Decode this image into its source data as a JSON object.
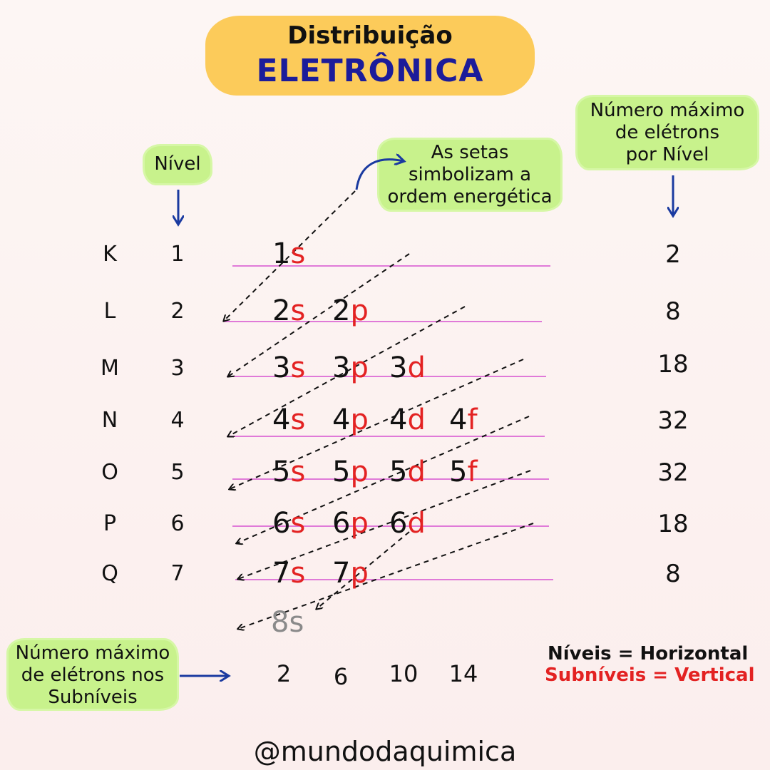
{
  "title": {
    "line1": "Distribuição",
    "line2": "ELETRÔNICA"
  },
  "notes": {
    "level": "Nível",
    "max_per_level": [
      "Número máximo",
      "de elétrons",
      "por Nível"
    ],
    "arrows": [
      "As setas",
      "simbolizam a",
      "ordem energética"
    ],
    "max_per_sublevel": [
      "Número máximo",
      "de elétrons nos",
      "Subníveis"
    ]
  },
  "rows": [
    {
      "shell": "K",
      "level": "1",
      "capacity": "2",
      "subs": [
        [
          "1",
          "s"
        ]
      ]
    },
    {
      "shell": "L",
      "level": "2",
      "capacity": "8",
      "subs": [
        [
          "2",
          "s"
        ],
        [
          "2",
          "p"
        ]
      ]
    },
    {
      "shell": "M",
      "level": "3",
      "capacity": "18",
      "subs": [
        [
          "3",
          "s"
        ],
        [
          "3",
          "p"
        ],
        [
          "3",
          "d"
        ]
      ]
    },
    {
      "shell": "N",
      "level": "4",
      "capacity": "32",
      "subs": [
        [
          "4",
          "s"
        ],
        [
          "4",
          "p"
        ],
        [
          "4",
          "d"
        ],
        [
          "4",
          "f"
        ]
      ]
    },
    {
      "shell": "O",
      "level": "5",
      "capacity": "32",
      "subs": [
        [
          "5",
          "s"
        ],
        [
          "5",
          "p"
        ],
        [
          "5",
          "d"
        ],
        [
          "5",
          "f"
        ]
      ]
    },
    {
      "shell": "P",
      "level": "6",
      "capacity": "18",
      "subs": [
        [
          "6",
          "s"
        ],
        [
          "6",
          "p"
        ],
        [
          "6",
          "d"
        ]
      ]
    },
    {
      "shell": "Q",
      "level": "7",
      "capacity": "8",
      "subs": [
        [
          "7",
          "s"
        ],
        [
          "7",
          "p"
        ]
      ]
    }
  ],
  "extra_sub": "8s",
  "sublevel_capacity": [
    "2",
    "6",
    "10",
    "14"
  ],
  "legend": {
    "levels": "Níveis = Horizontal",
    "sublevels": "Subníveis = Vertical"
  },
  "handle": "@mundodaquimica",
  "colors": {
    "title_bg": "#fccb5a",
    "title_text": "#1c1c9a",
    "note_bg": "#c8f28c",
    "sublevel_letter": "#e32222",
    "row_line": "#e07ad8",
    "arrow": "#1a3aa0"
  }
}
